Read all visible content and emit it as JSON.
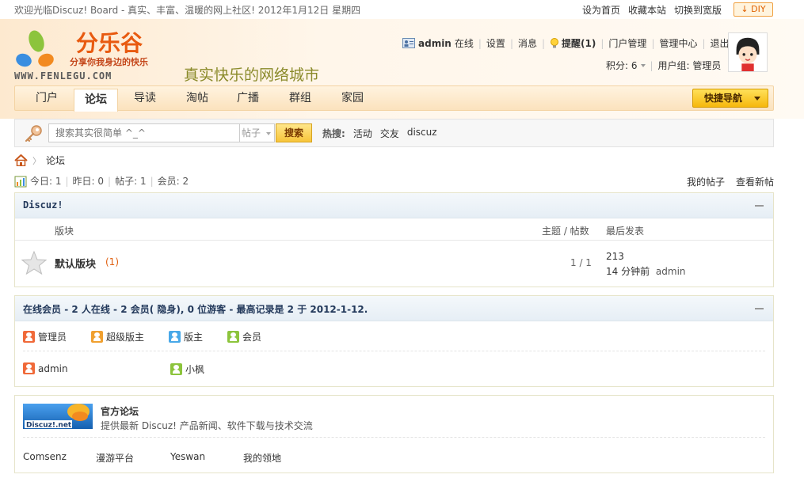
{
  "topbar": {
    "welcome": "欢迎光临Discuz! Board - 真实、丰富、温暖的网上社区!  2012年1月12日  星期四",
    "links": [
      "设为首页",
      "收藏本站",
      "切换到宽版"
    ],
    "diy_label": "DIY"
  },
  "header": {
    "logo_name": "分乐谷",
    "logo_tagline": "分享你我身边的快乐",
    "logo_url": "WWW.FENLEGU.COM",
    "slogan": "真实快乐的网络城市",
    "user": {
      "name": "admin",
      "status": "在线",
      "links": [
        "设置",
        "消息"
      ],
      "remind": "提醒(1)",
      "admin_links": [
        "门户管理",
        "管理中心",
        "退出"
      ],
      "credits_label": "积分: 6",
      "group_label": "用户组: 管理员"
    }
  },
  "nav": {
    "items": [
      "门户",
      "论坛",
      "导读",
      "淘帖",
      "广播",
      "群组",
      "家园"
    ],
    "active_index": 1,
    "quick_nav": "快捷导航"
  },
  "search": {
    "placeholder": "搜索其实很简单 ^_^",
    "type": "帖子",
    "button": "搜索",
    "hot_label": "热搜:",
    "hot_items": [
      "活动",
      "交友",
      "discuz"
    ]
  },
  "breadcrumb": {
    "current": "论坛"
  },
  "stats": {
    "today": "今日: 1",
    "yesterday": "昨日: 0",
    "posts": "帖子: 1",
    "members": "会员: 2",
    "my_posts": "我的帖子",
    "new_posts": "查看新帖"
  },
  "category": {
    "title": "Discuz!",
    "columns": {
      "forum": "版块",
      "threads_posts": "主题 / 帖数",
      "last_post": "最后发表"
    },
    "forums": [
      {
        "name": "默认版块",
        "today": "(1)",
        "threads_posts": "1 / 1",
        "last_tid": "213",
        "last_time": "14 分钟前",
        "last_author": "admin"
      }
    ]
  },
  "online": {
    "title": "在线会员",
    "summary": " - 2 人在线  - 2 会员( 隐身), 0 位游客  - 最高记录是  2 于  2012-1-12.",
    "legend": [
      "管理员",
      "超级版主",
      "版主",
      "会员"
    ],
    "users": [
      "admin",
      "小枫"
    ]
  },
  "partners": {
    "logo_text": "Discuz!.net",
    "title": "官方论坛",
    "desc": "提供最新  Discuz! 产品新闻、软件下载与技术交流",
    "links": [
      "Comsenz",
      "漫游平台",
      "Yeswan",
      "我的领地"
    ]
  }
}
